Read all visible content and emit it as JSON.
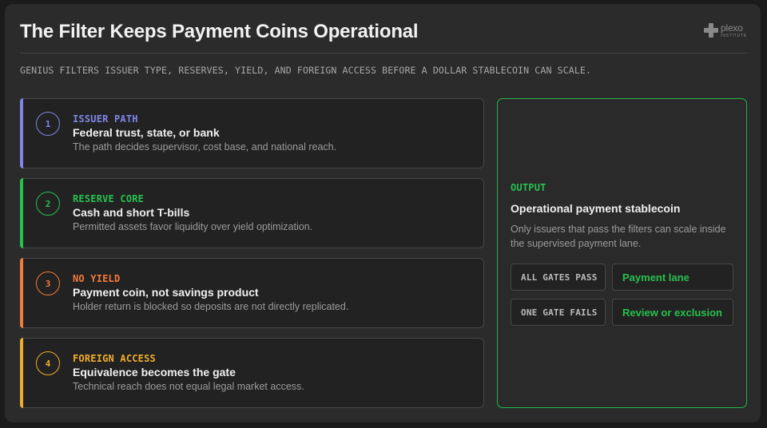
{
  "header": {
    "title": "The Filter Keeps Payment Coins Operational",
    "subtitle": "GENIUS FILTERS ISSUER TYPE, RESERVES, YIELD, AND FOREIGN ACCESS BEFORE A DOLLAR STABLECOIN CAN SCALE.",
    "logo": {
      "name": "plexo",
      "tagline": "INSTITUTE",
      "icon": "plus-cross-icon"
    }
  },
  "gates": [
    {
      "number": "1",
      "label": "ISSUER PATH",
      "headline": "Federal trust, state, or bank",
      "description": "The path decides supervisor, cost base, and national reach.",
      "color": "#7f86e8"
    },
    {
      "number": "2",
      "label": "RESERVE CORE",
      "headline": "Cash and short T-bills",
      "description": "Permitted assets favor liquidity over yield optimization.",
      "color": "#27c14f"
    },
    {
      "number": "3",
      "label": "NO YIELD",
      "headline": "Payment coin, not savings product",
      "description": "Holder return is blocked so deposits are not directly replicated.",
      "color": "#f37b3a"
    },
    {
      "number": "4",
      "label": "FOREIGN ACCESS",
      "headline": "Equivalence becomes the gate",
      "description": "Technical reach does not equal legal market access.",
      "color": "#f0ad2b"
    }
  ],
  "output": {
    "label": "OUTPUT",
    "title": "Operational payment stablecoin",
    "description": "Only issuers that pass the filters can scale inside the supervised payment lane.",
    "color": "#27c14f",
    "rules": [
      {
        "condition": "ALL GATES PASS",
        "result": "Payment lane"
      },
      {
        "condition": "ONE GATE FAILS",
        "result": "Review or exclusion"
      }
    ]
  }
}
